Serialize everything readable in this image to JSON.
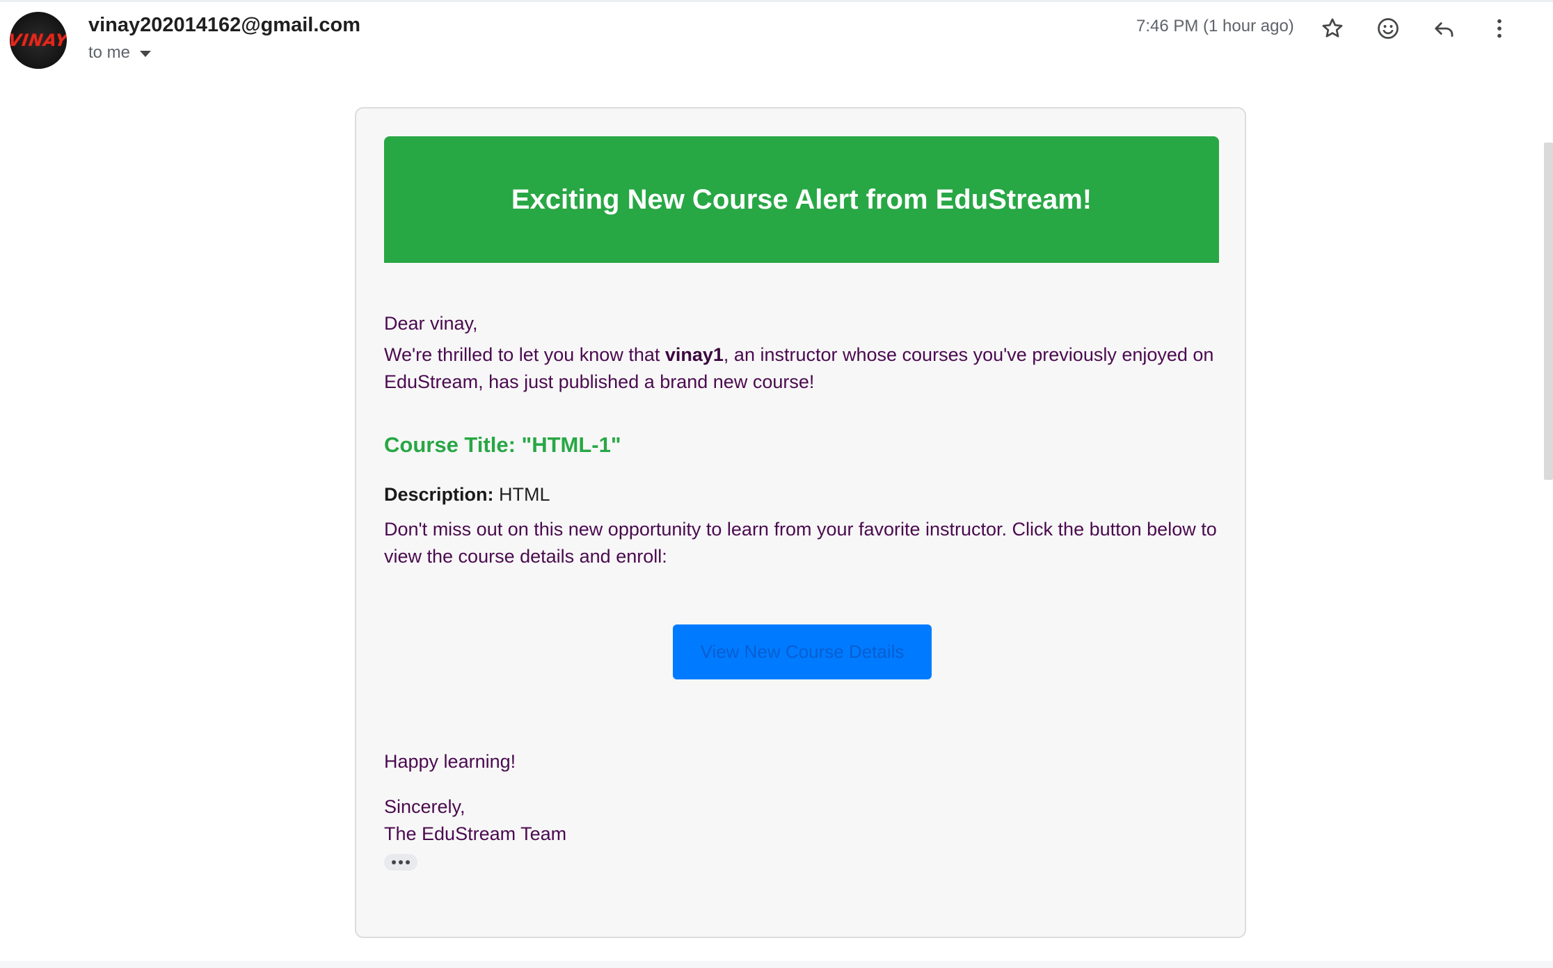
{
  "header": {
    "sender_email": "vinay202014162@gmail.com",
    "avatar_text": "VINAY",
    "recipient_label": "to me",
    "timestamp": "7:46 PM (1 hour ago)",
    "icons": [
      "star-icon",
      "emoji-icon",
      "reply-icon",
      "more-vert-icon"
    ]
  },
  "email": {
    "banner_title": "Exciting New Course Alert from EduStream!",
    "greeting": "Dear vinay,",
    "intro_before": "We're thrilled to let you know that ",
    "instructor_name": "vinay1",
    "intro_after": ", an instructor whose courses you've previously enjoyed on EduStream, has just published a brand new course!",
    "course_title": "Course Title: \"HTML-1\"",
    "description_label": "Description:",
    "description_value": " HTML",
    "call_to_action_text": "Don't miss out on this new opportunity to learn from your favorite instructor. Click the button below to view the course details and enroll:",
    "button_label": "View New Course Details",
    "closing": "Happy learning!",
    "signoff": "Sincerely,",
    "signature": "The EduStream Team"
  },
  "colors": {
    "banner": "#28a745",
    "button": "#007bff",
    "body_text": "#4a0a4f"
  }
}
